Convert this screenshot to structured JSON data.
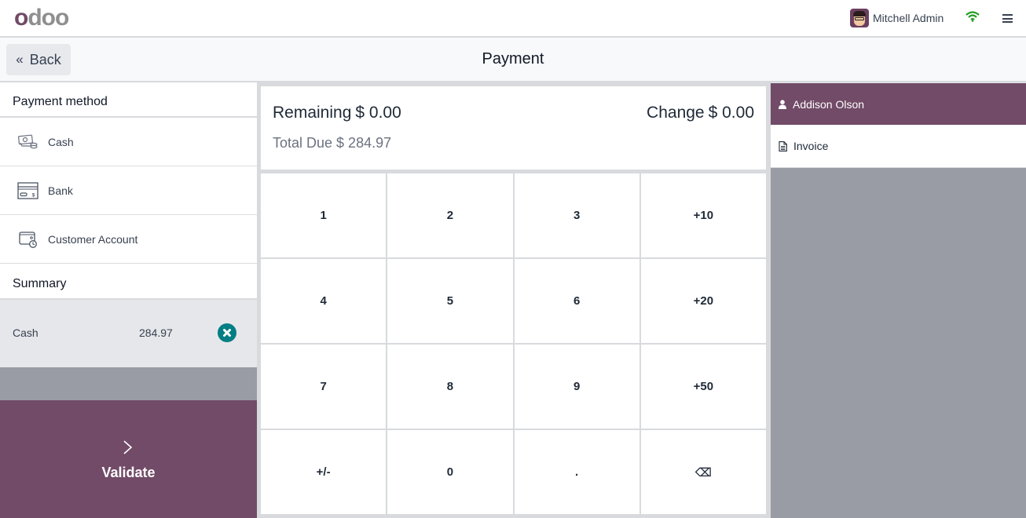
{
  "app": {
    "logo_first": "o",
    "logo_rest": "doo",
    "user_name": "Mitchell Admin",
    "icons": {
      "user": "avatar",
      "connection": "wifi-icon",
      "menu": "hamburger-menu-icon"
    }
  },
  "header": {
    "back_label": "Back",
    "back_icon": "«",
    "title": "Payment"
  },
  "payment_methods": {
    "title": "Payment method",
    "items": [
      {
        "label": "Cash",
        "icon": "cash-icon"
      },
      {
        "label": "Bank",
        "icon": "bank-card-icon"
      },
      {
        "label": "Customer Account",
        "icon": "customer-account-icon"
      }
    ]
  },
  "summary": {
    "title": "Summary",
    "lines": [
      {
        "method": "Cash",
        "amount": "284.97"
      }
    ]
  },
  "validate": {
    "label": "Validate",
    "icon": "chevron-right-icon"
  },
  "totals": {
    "remaining_label": "Remaining",
    "remaining_value": "$ 0.00",
    "change_label": "Change",
    "change_value": "$ 0.00",
    "total_due_label": "Total Due",
    "total_due_value": "$ 284.97"
  },
  "numpad": {
    "keys": [
      "1",
      "2",
      "3",
      "+10",
      "4",
      "5",
      "6",
      "+20",
      "7",
      "8",
      "9",
      "+50",
      "+/-",
      "0",
      ".",
      "⌫"
    ]
  },
  "customer": {
    "name": "Addison Olson",
    "invoice_label": "Invoice"
  },
  "colors": {
    "brand": "#714b67",
    "delete": "#017e84",
    "wifi": "#1f9d1f",
    "background_gray": "#9a9ca5"
  }
}
